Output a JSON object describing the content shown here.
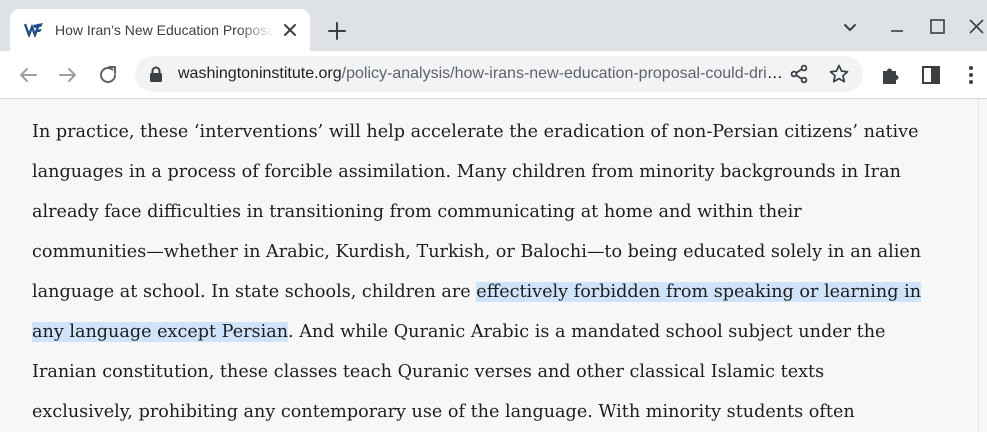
{
  "tab": {
    "title": "How Iran’s New Education Proposal Could Drive Minority Languages to Extinction",
    "favicon": "washington-institute-logo"
  },
  "toolbar": {
    "url_host": "washingtoninstitute.org",
    "url_path": "/policy-analysis/how-irans-new-education-proposal-could-drive-minority-languages-extinction"
  },
  "article": {
    "lines": [
      {
        "text": "In practice, these ‘interventions’ will help accelerate the eradication of non-Persian citizens’ native"
      },
      {
        "text": "languages in a process of forcible assimilation. Many children from minority backgrounds in Iran"
      },
      {
        "text": "already face difficulties in transitioning from communicating at home and within their"
      },
      {
        "text": "communities—whether in Arabic, Kurdish, Turkish, or Balochi—to being educated solely in an alien"
      },
      {
        "before": "language at school. In state schools, children are ",
        "highlight": "effectively forbidden from speaking or learning in"
      },
      {
        "highlight": "any language except Persian",
        "after": ". And while Quranic Arabic is a mandated school subject under the"
      },
      {
        "text": "Iranian constitution, these classes teach Quranic verses and other classical Islamic texts"
      },
      {
        "text": "exclusively, prohibiting any contemporary use of the language. With minority students often"
      }
    ]
  },
  "colors": {
    "tabstrip": "#dee1e6",
    "highlight": "#cfe3f9",
    "page_background": "#f7f7f7"
  }
}
